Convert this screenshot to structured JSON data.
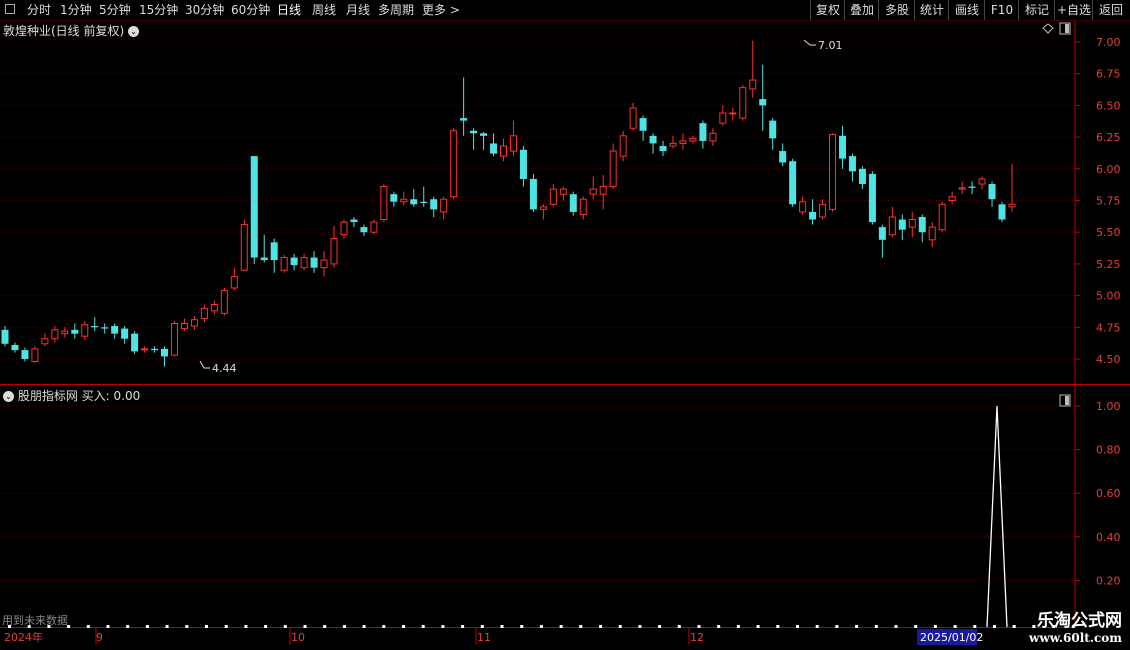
{
  "toolbar": {
    "left_tabs": [
      "分时",
      "1分钟",
      "5分钟",
      "15分钟",
      "30分钟",
      "60分钟",
      "日线",
      "周线",
      "月线",
      "多周期",
      "更多 >"
    ],
    "active": "日线",
    "right_buttons": [
      "复权",
      "叠加",
      "多股",
      "统计",
      "画线",
      "F10",
      "标记",
      "+自选",
      "返回"
    ]
  },
  "main": {
    "title": "敦煌种业(日线 前复权)",
    "high_label": "7.01",
    "low_label": "4.44",
    "price_ticks": [
      "7.00",
      "6.75",
      "6.50",
      "6.25",
      "6.00",
      "5.75",
      "5.50",
      "5.25",
      "5.00",
      "4.75",
      "4.50"
    ]
  },
  "indicator": {
    "title": "股朋指标网",
    "value_label": "买入: 0.00",
    "ticks": [
      "1.00",
      "0.80",
      "0.60",
      "0.40",
      "0.20"
    ],
    "spike_value": 1.0
  },
  "footer_note": "用到未来数据",
  "date_axis": {
    "year": "2024年",
    "months": [
      "9",
      "10",
      "11",
      "12"
    ],
    "current": "2025/01/02"
  },
  "colors": {
    "up": "#ff3030",
    "down": "#4fe4e4",
    "axis": "#c00000",
    "grid": "#5a0000"
  },
  "watermark": {
    "name": "乐淘公式网",
    "url": "www.60lt.com"
  },
  "chart_data": {
    "type": "candlestick",
    "title": "敦煌种业(日线 前复权)",
    "ylim": [
      4.35,
      7.12
    ],
    "candles": [
      [
        4.73,
        4.62,
        4.76,
        4.6
      ],
      [
        4.61,
        4.57,
        4.63,
        4.55
      ],
      [
        4.57,
        4.5,
        4.59,
        4.48
      ],
      [
        4.48,
        4.58,
        4.6,
        4.47
      ],
      [
        4.62,
        4.66,
        4.7,
        4.6
      ],
      [
        4.66,
        4.73,
        4.76,
        4.63
      ],
      [
        4.7,
        4.72,
        4.75,
        4.67
      ],
      [
        4.73,
        4.7,
        4.78,
        4.66
      ],
      [
        4.68,
        4.77,
        4.8,
        4.65
      ],
      [
        4.76,
        4.75,
        4.83,
        4.72
      ],
      [
        4.75,
        4.74,
        4.78,
        4.7
      ],
      [
        4.76,
        4.7,
        4.78,
        4.66
      ],
      [
        4.74,
        4.66,
        4.76,
        4.62
      ],
      [
        4.7,
        4.56,
        4.72,
        4.54
      ],
      [
        4.58,
        4.58,
        4.6,
        4.55
      ],
      [
        4.58,
        4.57,
        4.6,
        4.55
      ],
      [
        4.58,
        4.52,
        4.6,
        4.44
      ],
      [
        4.53,
        4.78,
        4.8,
        4.52
      ],
      [
        4.74,
        4.78,
        4.82,
        4.72
      ],
      [
        4.76,
        4.81,
        4.84,
        4.73
      ],
      [
        4.82,
        4.9,
        4.93,
        4.79
      ],
      [
        4.88,
        4.93,
        4.96,
        4.85
      ],
      [
        4.86,
        5.04,
        5.06,
        4.84
      ],
      [
        5.06,
        5.15,
        5.22,
        5.04
      ],
      [
        5.2,
        5.56,
        5.6,
        5.2
      ],
      [
        6.1,
        5.3,
        6.1,
        5.25
      ],
      [
        5.3,
        5.28,
        5.48,
        5.26
      ],
      [
        5.42,
        5.28,
        5.45,
        5.18
      ],
      [
        5.2,
        5.3,
        5.32,
        5.18
      ],
      [
        5.3,
        5.24,
        5.33,
        5.2
      ],
      [
        5.22,
        5.3,
        5.33,
        5.2
      ],
      [
        5.3,
        5.22,
        5.35,
        5.18
      ],
      [
        5.22,
        5.28,
        5.35,
        5.15
      ],
      [
        5.25,
        5.45,
        5.55,
        5.22
      ],
      [
        5.48,
        5.58,
        5.6,
        5.45
      ],
      [
        5.6,
        5.58,
        5.62,
        5.54
      ],
      [
        5.54,
        5.5,
        5.56,
        5.47
      ],
      [
        5.5,
        5.58,
        5.6,
        5.48
      ],
      [
        5.6,
        5.86,
        5.88,
        5.58
      ],
      [
        5.8,
        5.74,
        5.82,
        5.7
      ],
      [
        5.74,
        5.76,
        5.82,
        5.71
      ],
      [
        5.76,
        5.72,
        5.84,
        5.7
      ],
      [
        5.74,
        5.73,
        5.86,
        5.7
      ],
      [
        5.76,
        5.68,
        5.78,
        5.62
      ],
      [
        5.66,
        5.76,
        5.78,
        5.6
      ],
      [
        5.78,
        6.3,
        6.32,
        5.76
      ],
      [
        6.4,
        6.38,
        6.72,
        6.26
      ],
      [
        6.3,
        6.28,
        6.32,
        6.15
      ],
      [
        6.28,
        6.26,
        6.29,
        6.15
      ],
      [
        6.2,
        6.12,
        6.28,
        6.1
      ],
      [
        6.1,
        6.18,
        6.24,
        6.06
      ],
      [
        6.14,
        6.26,
        6.38,
        6.1
      ],
      [
        6.15,
        5.92,
        6.18,
        5.86
      ],
      [
        5.92,
        5.68,
        5.96,
        5.66
      ],
      [
        5.68,
        5.7,
        5.72,
        5.6
      ],
      [
        5.72,
        5.84,
        5.88,
        5.7
      ],
      [
        5.8,
        5.84,
        5.86,
        5.75
      ],
      [
        5.8,
        5.66,
        5.82,
        5.63
      ],
      [
        5.64,
        5.76,
        5.78,
        5.6
      ],
      [
        5.8,
        5.84,
        5.94,
        5.76
      ],
      [
        5.8,
        5.86,
        5.95,
        5.68
      ],
      [
        5.86,
        6.14,
        6.2,
        5.84
      ],
      [
        6.1,
        6.26,
        6.3,
        6.06
      ],
      [
        6.32,
        6.48,
        6.52,
        6.3
      ],
      [
        6.4,
        6.3,
        6.42,
        6.22
      ],
      [
        6.26,
        6.2,
        6.28,
        6.12
      ],
      [
        6.18,
        6.14,
        6.22,
        6.1
      ],
      [
        6.18,
        6.2,
        6.26,
        6.16
      ],
      [
        6.2,
        6.22,
        6.28,
        6.15
      ],
      [
        6.22,
        6.24,
        6.26,
        6.2
      ],
      [
        6.36,
        6.22,
        6.38,
        6.16
      ],
      [
        6.22,
        6.28,
        6.32,
        6.18
      ],
      [
        6.36,
        6.44,
        6.5,
        6.34
      ],
      [
        6.44,
        6.44,
        6.48,
        6.38
      ],
      [
        6.4,
        6.64,
        6.66,
        6.38
      ],
      [
        6.63,
        6.7,
        7.01,
        6.56
      ],
      [
        6.55,
        6.5,
        6.82,
        6.3
      ],
      [
        6.38,
        6.24,
        6.4,
        6.15
      ],
      [
        6.14,
        6.05,
        6.2,
        6.02
      ],
      [
        6.06,
        5.72,
        6.08,
        5.7
      ],
      [
        5.66,
        5.74,
        5.78,
        5.64
      ],
      [
        5.66,
        5.6,
        5.76,
        5.56
      ],
      [
        5.62,
        5.72,
        5.76,
        5.6
      ],
      [
        5.68,
        6.27,
        6.28,
        5.66
      ],
      [
        6.26,
        6.08,
        6.34,
        6.0
      ],
      [
        6.1,
        5.98,
        6.12,
        5.9
      ],
      [
        6.0,
        5.88,
        6.02,
        5.84
      ],
      [
        5.96,
        5.58,
        5.98,
        5.56
      ],
      [
        5.54,
        5.44,
        5.56,
        5.3
      ],
      [
        5.48,
        5.62,
        5.7,
        5.46
      ],
      [
        5.6,
        5.52,
        5.64,
        5.44
      ],
      [
        5.54,
        5.6,
        5.66,
        5.46
      ],
      [
        5.62,
        5.5,
        5.64,
        5.42
      ],
      [
        5.44,
        5.54,
        5.58,
        5.38
      ],
      [
        5.52,
        5.72,
        5.74,
        5.5
      ],
      [
        5.75,
        5.78,
        5.82,
        5.72
      ],
      [
        5.84,
        5.85,
        5.9,
        5.8
      ],
      [
        5.86,
        5.85,
        5.9,
        5.8
      ],
      [
        5.88,
        5.92,
        5.94,
        5.84
      ],
      [
        5.88,
        5.76,
        5.9,
        5.7
      ],
      [
        5.72,
        5.6,
        5.74,
        5.58
      ],
      [
        5.7,
        5.72,
        6.04,
        5.66
      ]
    ]
  }
}
